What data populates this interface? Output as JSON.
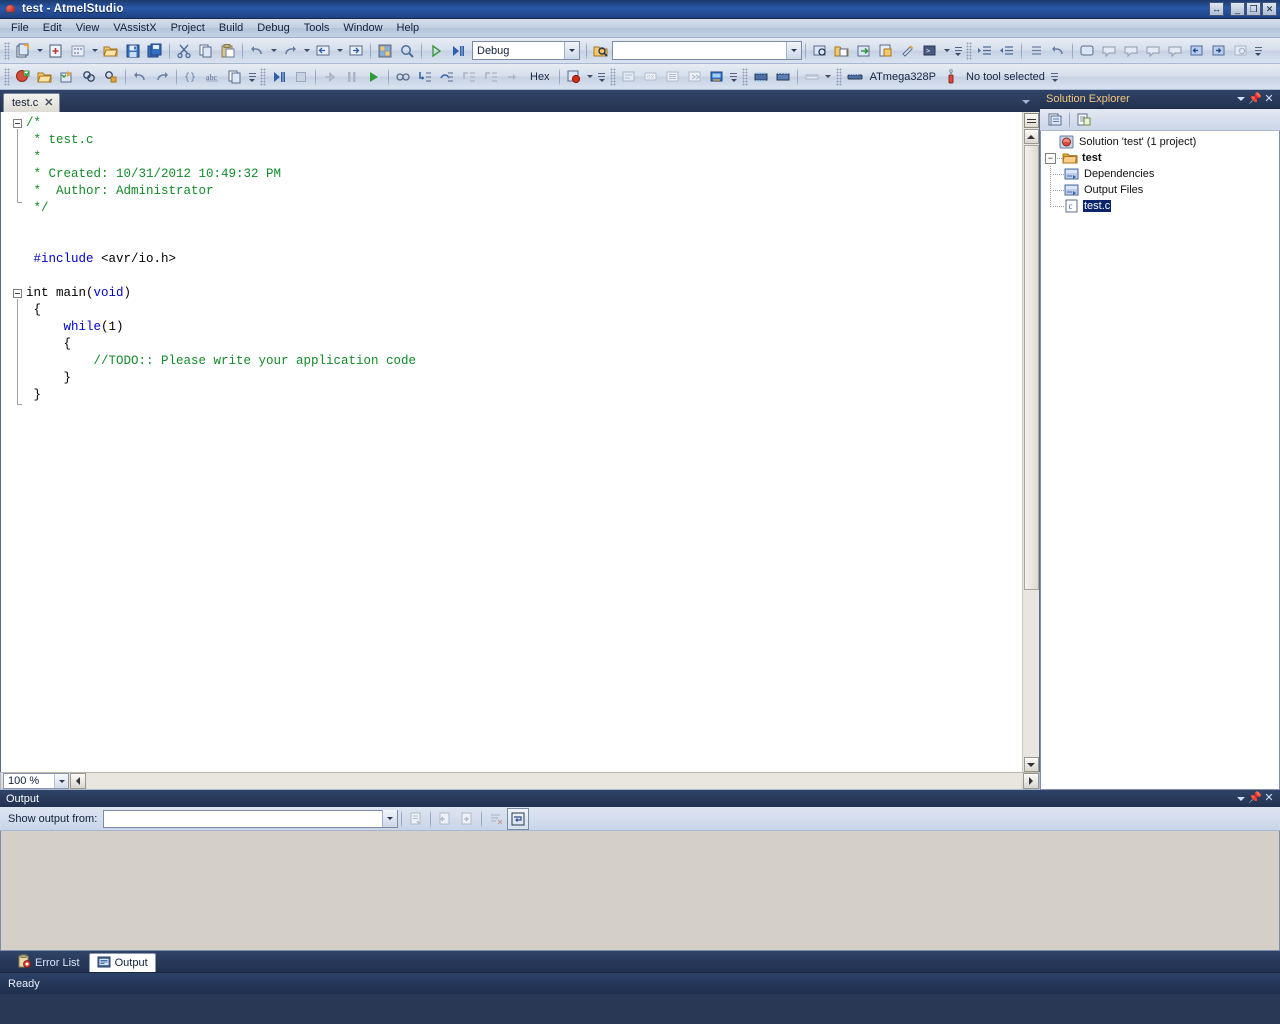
{
  "window": {
    "title": "test - AtmelStudio",
    "app_icon": "atmel-logo-icon",
    "buttons": {
      "resize": "resize-handle-icon",
      "minimize": "minimize-icon",
      "restore": "restore-icon",
      "close": "close-icon"
    }
  },
  "menubar": {
    "items": [
      {
        "label": "File"
      },
      {
        "label": "Edit"
      },
      {
        "label": "View"
      },
      {
        "label": "VAssistX"
      },
      {
        "label": "Project"
      },
      {
        "label": "Build"
      },
      {
        "label": "Debug"
      },
      {
        "label": "Tools"
      },
      {
        "label": "Window"
      },
      {
        "label": "Help"
      }
    ]
  },
  "toolbar_standard": {
    "config_combo": {
      "value": "Debug"
    },
    "search_combo": {
      "value": "",
      "placeholder": ""
    }
  },
  "toolbar_debug": {
    "hex_label": "Hex",
    "device_label": "ATmega328P",
    "tool_label": "No tool selected"
  },
  "editor": {
    "tabs": [
      {
        "label": "test.c",
        "close": "✕",
        "active": true
      }
    ],
    "zoom": "100 %",
    "code_lines": [
      {
        "indent": 0,
        "fold": "open",
        "tokens": [
          {
            "t": "/*",
            "c": "cmt"
          }
        ]
      },
      {
        "indent": 0,
        "tokens": [
          {
            "t": " * test.c",
            "c": "cmt"
          }
        ]
      },
      {
        "indent": 0,
        "tokens": [
          {
            "t": " *",
            "c": "cmt"
          }
        ]
      },
      {
        "indent": 0,
        "tokens": [
          {
            "t": " * Created: 10/31/2012 10:49:32 PM",
            "c": "cmt"
          }
        ]
      },
      {
        "indent": 0,
        "tokens": [
          {
            "t": " *  Author: Administrator",
            "c": "cmt"
          }
        ]
      },
      {
        "indent": 0,
        "tokens": [
          {
            "t": " */",
            "c": "cmt"
          }
        ]
      },
      {
        "indent": 0,
        "tokens": []
      },
      {
        "indent": 0,
        "tokens": []
      },
      {
        "indent": 0,
        "tokens": [
          {
            "t": " #include",
            "c": "pre"
          },
          {
            "t": " <avr/io.h>",
            "c": "txt"
          }
        ]
      },
      {
        "indent": 0,
        "tokens": []
      },
      {
        "indent": 0,
        "fold": "open",
        "tokens": [
          {
            "t": "int main(",
            "c": "txt"
          },
          {
            "t": "void",
            "c": "kw"
          },
          {
            "t": ")",
            "c": "txt"
          }
        ]
      },
      {
        "indent": 0,
        "tokens": [
          {
            "t": " {",
            "c": "txt"
          }
        ]
      },
      {
        "indent": 0,
        "tokens": [
          {
            "t": "     ",
            "c": "txt"
          },
          {
            "t": "while",
            "c": "kw"
          },
          {
            "t": "(1)",
            "c": "txt"
          }
        ]
      },
      {
        "indent": 0,
        "tokens": [
          {
            "t": "     {",
            "c": "txt"
          }
        ]
      },
      {
        "indent": 0,
        "tokens": [
          {
            "t": "         //TODO:: Please write your application code",
            "c": "cmt"
          }
        ]
      },
      {
        "indent": 0,
        "tokens": [
          {
            "t": "     }",
            "c": "txt"
          }
        ]
      },
      {
        "indent": 0,
        "tokens": [
          {
            "t": " }",
            "c": "txt"
          }
        ]
      }
    ]
  },
  "solution_explorer": {
    "title": "Solution Explorer",
    "title_buttons": {
      "dropdown": "chevron-down-icon",
      "pin": "pin-icon",
      "close": "close-icon"
    },
    "toolbar": [
      {
        "name": "properties-icon"
      },
      {
        "name": "show-all-files-icon"
      }
    ],
    "tree": [
      {
        "label": "Solution 'test' (1 project)",
        "level": 0,
        "icon": "solution-icon",
        "toggle": "",
        "bold": false,
        "selected": false
      },
      {
        "label": "test",
        "level": 1,
        "icon": "project-folder-icon",
        "toggle": "−",
        "bold": true,
        "selected": false
      },
      {
        "label": "Dependencies",
        "level": 2,
        "icon": "dependencies-icon",
        "toggle": "",
        "bold": false,
        "selected": false
      },
      {
        "label": "Output Files",
        "level": 2,
        "icon": "output-files-icon",
        "toggle": "",
        "bold": false,
        "selected": false
      },
      {
        "label": "test.c",
        "level": 2,
        "icon": "c-file-icon",
        "toggle": "",
        "bold": false,
        "selected": true
      }
    ]
  },
  "output_panel": {
    "title": "Output",
    "title_buttons": {
      "dropdown": "chevron-down-icon",
      "pin": "pin-icon",
      "close": "close-icon"
    },
    "show_output_from_label": "Show output from:",
    "show_output_from_value": "",
    "toolbar_icons": [
      {
        "name": "find-message-icon",
        "enabled": false
      },
      {
        "name": "go-to-previous-message-icon",
        "enabled": false
      },
      {
        "name": "go-to-next-message-icon",
        "enabled": false
      },
      {
        "name": "clear-all-icon",
        "enabled": false
      },
      {
        "name": "toggle-word-wrap-icon",
        "enabled": true
      }
    ],
    "body_text": "",
    "tabs": [
      {
        "label": "Error List",
        "icon": "error-list-icon",
        "active": false
      },
      {
        "label": "Output",
        "icon": "output-icon",
        "active": true
      }
    ]
  },
  "statusbar": {
    "message": "Ready"
  },
  "colors": {
    "title_bar": "#2a58a8",
    "accent_panel_title": "#f5c77e",
    "comment_green": "#128a28",
    "keyword_blue": "#0000d0",
    "type_teal": "#2b91af",
    "selection_blue": "#0a246a",
    "chrome_blue": "#2b3c59"
  }
}
